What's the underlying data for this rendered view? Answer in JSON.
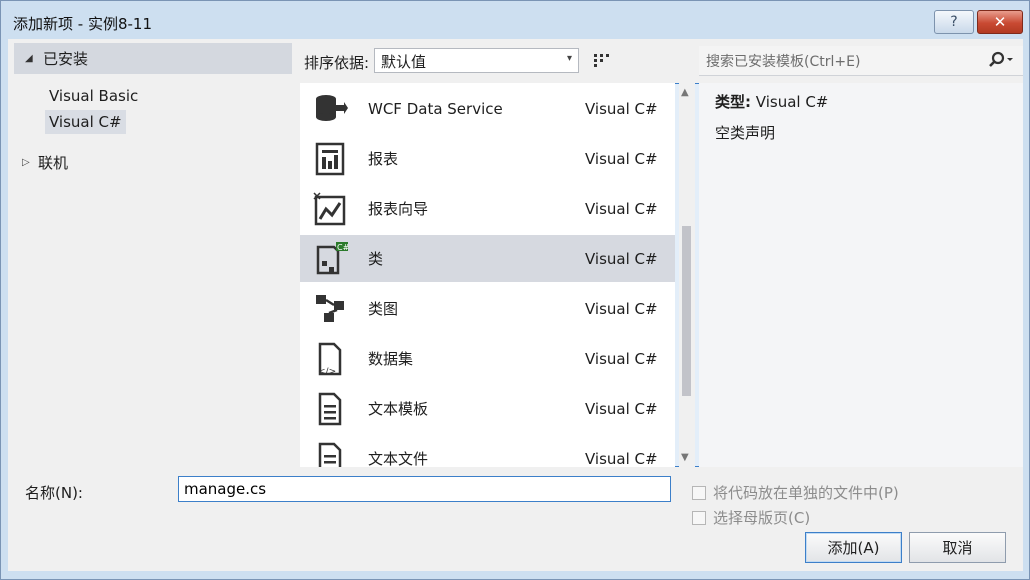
{
  "window": {
    "title": "添加新项 - 实例8-11",
    "help_glyph": "?",
    "close_glyph": "✕"
  },
  "tree": {
    "installed": {
      "arrow": "◢",
      "label": "已安装"
    },
    "children": [
      "Visual Basic",
      "Visual C#"
    ],
    "selected_index": 1,
    "online": {
      "arrow": "▷",
      "label": "联机"
    }
  },
  "toolbar": {
    "sort_label": "排序依据:",
    "sort_value": "默认值",
    "caret": "▾"
  },
  "templates": [
    {
      "icon": "wcf-service-icon",
      "name": "WCF Data Service",
      "lang": "Visual C#"
    },
    {
      "icon": "report-icon",
      "name": "报表",
      "lang": "Visual C#"
    },
    {
      "icon": "report-wizard-icon",
      "name": "报表向导",
      "lang": "Visual C#"
    },
    {
      "icon": "class-icon",
      "name": "类",
      "lang": "Visual C#"
    },
    {
      "icon": "class-diagram-icon",
      "name": "类图",
      "lang": "Visual C#"
    },
    {
      "icon": "dataset-icon",
      "name": "数据集",
      "lang": "Visual C#"
    },
    {
      "icon": "text-template-icon",
      "name": "文本模板",
      "lang": "Visual C#"
    },
    {
      "icon": "text-file-icon",
      "name": "文本文件",
      "lang": "Visual C#"
    }
  ],
  "selected_template": 3,
  "scrollbar": {
    "up": "▲",
    "down": "▼"
  },
  "search": {
    "placeholder": "搜索已安装模板(Ctrl+E)"
  },
  "detail": {
    "type_label": "类型:",
    "type_value": "Visual C#",
    "description": "空类声明"
  },
  "name_field": {
    "label": "名称(N):",
    "value": "manage.cs"
  },
  "checkboxes": [
    {
      "label": "将代码放在单独的文件中(P)",
      "checked": false
    },
    {
      "label": "选择母版页(C)",
      "checked": false
    }
  ],
  "buttons": {
    "add": "添加(A)",
    "cancel": "取消"
  }
}
